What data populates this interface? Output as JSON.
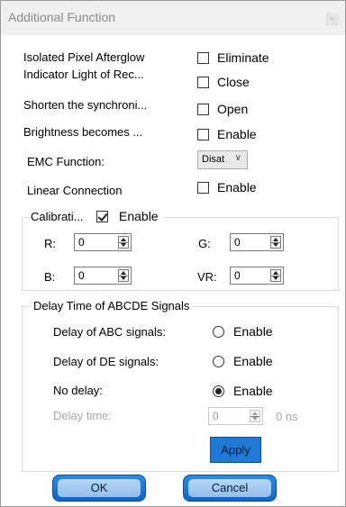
{
  "window": {
    "title": "Additional Function",
    "close_glyph": "×"
  },
  "options": {
    "isolated_pixel_label": "Isolated Pixel Afterglow",
    "isolated_pixel_check": "Eliminate",
    "indicator_light_label": "Indicator Light of Rec...",
    "indicator_light_check": "Close",
    "shorten_sync_label": "Shorten the synchroni...",
    "shorten_sync_check": "Open",
    "brightness_label": "Brightness becomes ...",
    "brightness_check": "Enable",
    "emc_label": "EMC Function:",
    "emc_selected": "Disat",
    "linear_label": "Linear Connection",
    "linear_check": "Enable"
  },
  "calibration": {
    "group_label": "Calibrati...",
    "enable_label": "Enable",
    "enabled": true,
    "r_label": "R:",
    "r_value": "0",
    "g_label": "G:",
    "g_value": "0",
    "b_label": "B:",
    "b_value": "0",
    "vr_label": "VR:",
    "vr_value": "0"
  },
  "delay": {
    "group_label": "Delay Time of ABCDE Signals",
    "abc_label": "Delay of ABC signals:",
    "abc_option": "Enable",
    "de_label": "Delay of DE signals:",
    "de_option": "Enable",
    "none_label": "No delay:",
    "none_option": "Enable",
    "selected": "No delay",
    "time_label": "Delay time:",
    "time_value": "0",
    "time_unit": "0 ns",
    "apply_label": "Apply"
  },
  "footer": {
    "ok_label": "OK",
    "cancel_label": "Cancel"
  },
  "colors": {
    "accent_button": "#1e7ad4",
    "title_text": "#8a8a8a"
  }
}
